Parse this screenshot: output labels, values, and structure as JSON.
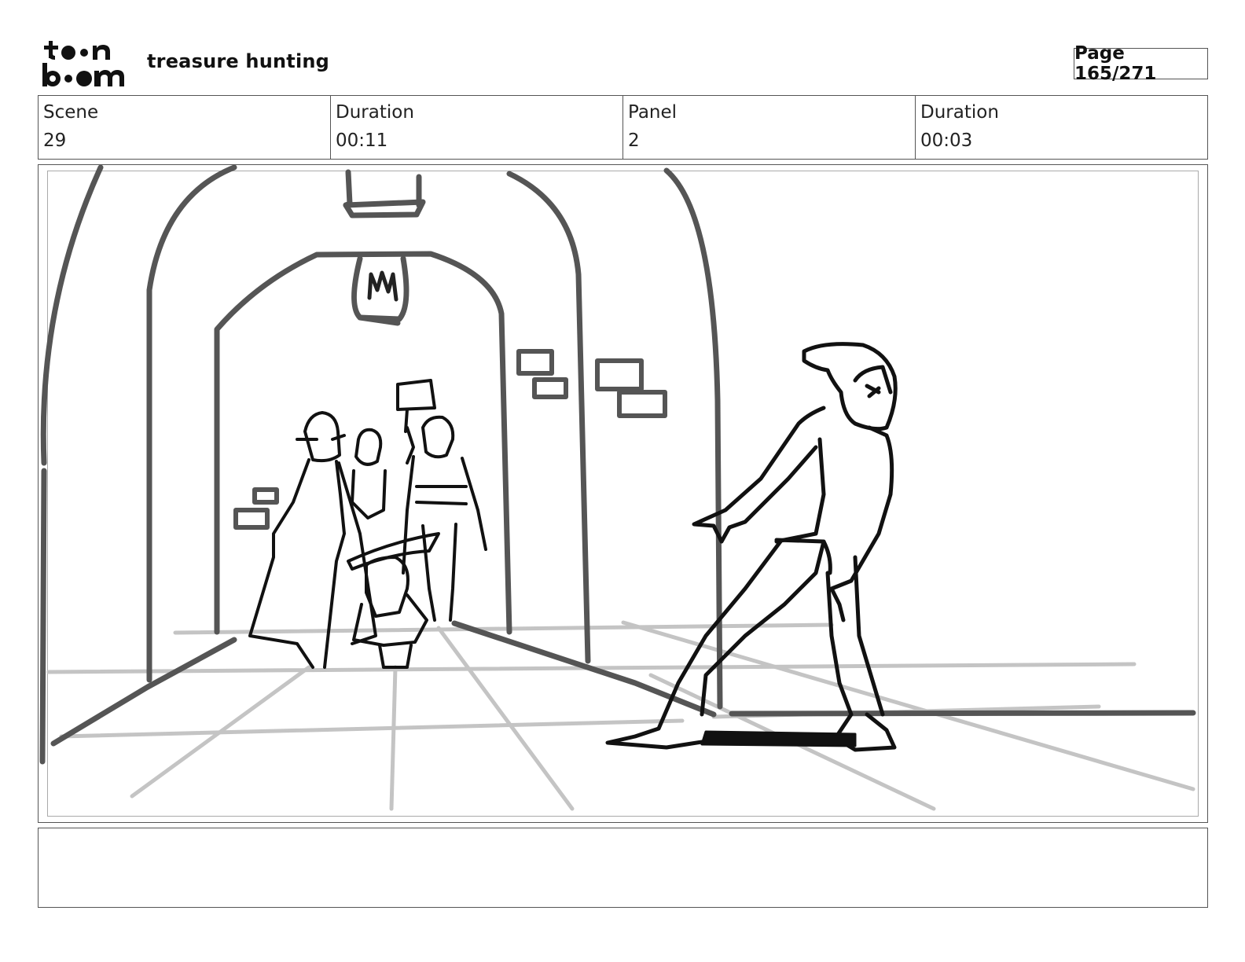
{
  "header": {
    "logo_name": "toon-boom-logo",
    "project_title": "treasure hunting",
    "page_label": "Page 165/271"
  },
  "info": [
    {
      "label": "Scene",
      "value": "29"
    },
    {
      "label": "Duration",
      "value": "00:11"
    },
    {
      "label": "Panel",
      "value": "2"
    },
    {
      "label": "Duration",
      "value": "00:03"
    }
  ],
  "panel": {
    "image_name": "storyboard-sketch-corridor"
  },
  "notes": {
    "text": ""
  },
  "colors": {
    "ink": "#111111",
    "line_gray": "#555555",
    "floor_gray": "#bdbdbd"
  }
}
